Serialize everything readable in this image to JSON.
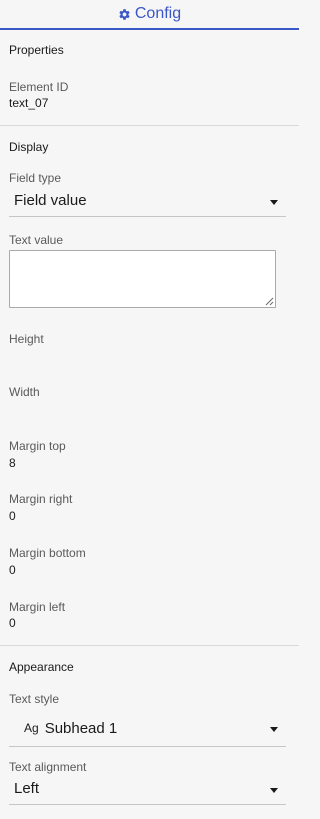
{
  "header": {
    "title": "Config",
    "icon": "gear-icon",
    "accent": "#3a57c7"
  },
  "properties": {
    "section_title": "Properties",
    "element_id_label": "Element ID",
    "element_id_value": "text_07"
  },
  "display": {
    "section_title": "Display",
    "field_type_label": "Field type",
    "field_type_value": "Field value",
    "text_value_label": "Text value",
    "text_value": "",
    "height_label": "Height",
    "height_value": "",
    "width_label": "Width",
    "width_value": "",
    "margin_top_label": "Margin top",
    "margin_top_value": "8",
    "margin_right_label": "Margin right",
    "margin_right_value": "0",
    "margin_bottom_label": "Margin bottom",
    "margin_bottom_value": "0",
    "margin_left_label": "Margin left",
    "margin_left_value": "0"
  },
  "appearance": {
    "section_title": "Appearance",
    "text_style_label": "Text style",
    "text_style_prefix": "Ag",
    "text_style_value": "Subhead 1",
    "text_alignment_label": "Text alignment",
    "text_alignment_value": "Left"
  }
}
